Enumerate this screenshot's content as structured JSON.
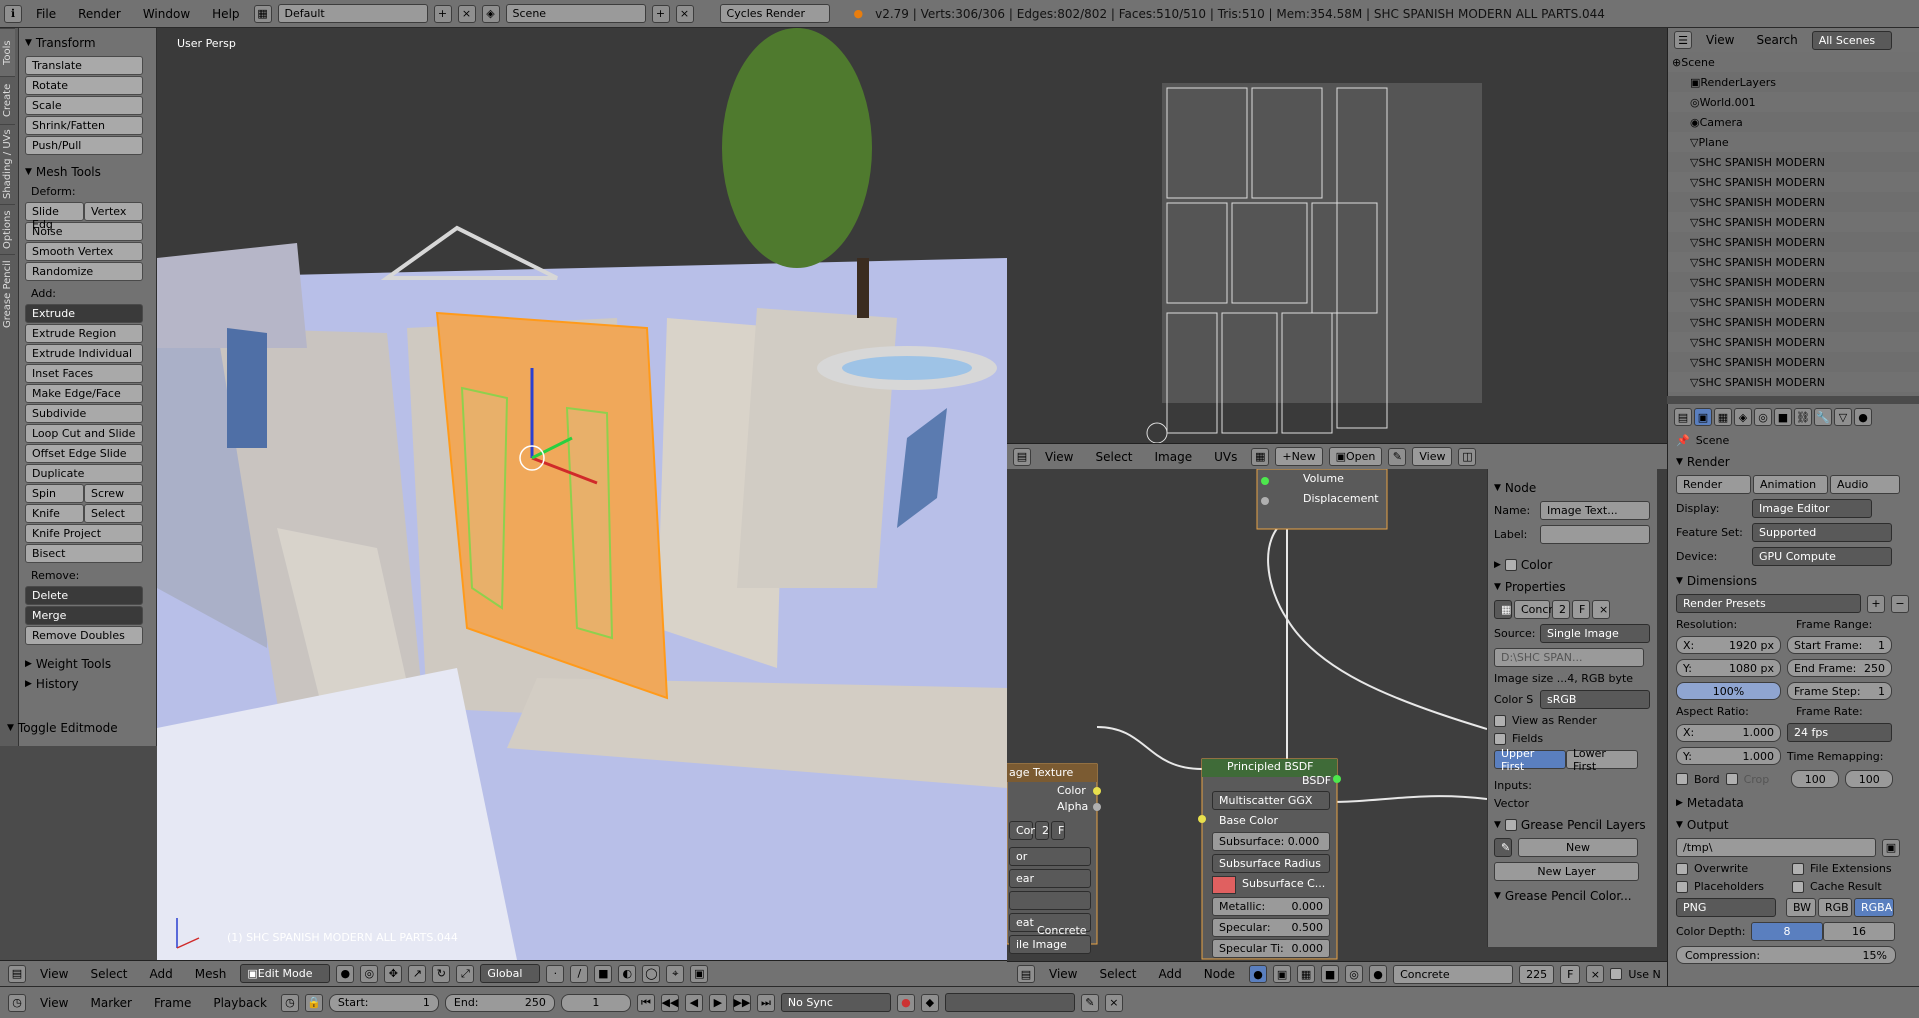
{
  "topbar": {
    "menus": [
      "File",
      "Render",
      "Window",
      "Help"
    ],
    "layout": "Default",
    "scene": "Scene",
    "engine": "Cycles Render",
    "stats": "v2.79 | Verts:306/306 | Edges:802/802 | Faces:510/510 | Tris:510 | Mem:354.58M | SHC SPANISH MODERN ALL PARTS.044"
  },
  "shelf": {
    "tabs": [
      "Tools",
      "Create",
      "Shading / UVs",
      "Options",
      "Grease Pencil"
    ],
    "transform_title": "Transform",
    "transform": [
      "Translate",
      "Rotate",
      "Scale",
      "Shrink/Fatten",
      "Push/Pull"
    ],
    "mesh_title": "Mesh Tools",
    "deform_label": "Deform:",
    "slide_edge": "Slide Edg",
    "vertex": "Vertex",
    "deform": [
      "Noise",
      "Smooth Vertex",
      "Randomize"
    ],
    "add_label": "Add:",
    "extrude": "Extrude",
    "add": [
      "Extrude Region",
      "Extrude Individual",
      "Inset Faces",
      "Make Edge/Face",
      "Subdivide",
      "Loop Cut and Slide",
      "Offset Edge Slide",
      "Duplicate"
    ],
    "spin": "Spin",
    "screw": "Screw",
    "knife": "Knife",
    "select": "Select",
    "knife_project": "Knife Project",
    "bisect": "Bisect",
    "remove_label": "Remove:",
    "delete": "Delete",
    "merge": "Merge",
    "remove_doubles": "Remove Doubles",
    "weight_tools": "Weight Tools",
    "history": "History",
    "toggle_editmode": "Toggle Editmode"
  },
  "viewport": {
    "label": "User Persp",
    "object": "(1) SHC SPANISH MODERN ALL PARTS.044",
    "node_label": "Concrete"
  },
  "vp_header": {
    "menus": [
      "View",
      "Select",
      "Add",
      "Mesh"
    ],
    "mode": "Edit Mode",
    "orientation": "Global"
  },
  "node_header_top": {
    "menus": [
      "View",
      "Select",
      "Image",
      "UVs"
    ],
    "new": "New",
    "open": "Open",
    "view": "View"
  },
  "nodes": {
    "output_sockets": [
      "Volume",
      "Displacement"
    ],
    "image_texture": "age Texture",
    "image_sockets": [
      "Color",
      "Alpha"
    ],
    "image_fields": [
      "Con",
      "2",
      "F"
    ],
    "image_rows": [
      "or",
      "ear",
      "",
      "eat",
      "ile Image"
    ],
    "bsdf_title": "Principled BSDF",
    "bsdf_out": "BSDF",
    "distribution": "Multiscatter GGX",
    "base_color": "Base Color",
    "subsurface": "Subsurface: 0.000",
    "subsurface_radius": "Subsurface Radius",
    "subsurface_color": "Subsurface C...",
    "metallic": "Metallic:",
    "metallic_v": "0.000",
    "specular": "Specular:",
    "specular_v": "0.500",
    "spec_tint": "Specular Ti:",
    "spec_tint_v": "0.000"
  },
  "node_side": {
    "node_title": "Node",
    "name_label": "Name:",
    "name_value": "Image Text...",
    "label_label": "Label:",
    "color_title": "Color",
    "properties_title": "Properties",
    "img_name": "Concr",
    "img_users": "2",
    "img_f": "F",
    "source_label": "Source:",
    "source_value": "Single Image",
    "path": "D:\\SHC SPAN...",
    "img_info": "Image size ...4, RGB byte",
    "colorspace_label": "Color S",
    "colorspace_value": "sRGB",
    "view_as_render": "View as Render",
    "fields": "Fields",
    "upper_first": "Upper First",
    "lower_first": "Lower First",
    "inputs": "Inputs:",
    "vector": "Vector",
    "grease_title": "Grease Pencil Layers",
    "new": "New",
    "new_layer": "New Layer",
    "grease_colors": "Grease Pencil Color..."
  },
  "node_header_bottom": {
    "menus": [
      "View",
      "Select",
      "Add",
      "Node"
    ],
    "material": "Concrete",
    "users": "225",
    "f": "F",
    "use_nodes": "Use N"
  },
  "outliner": {
    "menus": [
      "View",
      "Search"
    ],
    "filter": "All Scenes",
    "rows": [
      "Scene",
      "RenderLayers",
      "World.001",
      "Camera",
      "Plane",
      "SHC SPANISH MODERN",
      "SHC SPANISH MODERN",
      "SHC SPANISH MODERN",
      "SHC SPANISH MODERN",
      "SHC SPANISH MODERN",
      "SHC SPANISH MODERN",
      "SHC SPANISH MODERN",
      "SHC SPANISH MODERN",
      "SHC SPANISH MODERN",
      "SHC SPANISH MODERN",
      "SHC SPANISH MODERN",
      "SHC SPANISH MODERN"
    ]
  },
  "props": {
    "scene": "Scene",
    "render_title": "Render",
    "render": "Render",
    "animation": "Animation",
    "audio": "Audio",
    "display_label": "Display:",
    "display_value": "Image Editor",
    "feature_label": "Feature Set:",
    "feature_value": "Supported",
    "device_label": "Device:",
    "device_value": "GPU Compute",
    "dimensions_title": "Dimensions",
    "presets": "Render Presets",
    "resolution": "Resolution:",
    "frame_range": "Frame Range:",
    "res_x": "X:",
    "res_x_v": "1920 px",
    "start": "Start Frame:",
    "start_v": "1",
    "res_y": "Y:",
    "res_y_v": "1080 px",
    "end": "End Frame:",
    "end_v": "250",
    "pct": "100%",
    "step": "Frame Step:",
    "step_v": "1",
    "aspect": "Aspect Ratio:",
    "frame_rate": "Frame Rate:",
    "asp_x": "X:",
    "asp_x_v": "1.000",
    "fps": "24 fps",
    "asp_y": "Y:",
    "asp_y_v": "1.000",
    "time_remap": "Time Remapping:",
    "bord": "Bord",
    "crop": "Crop",
    "remap_old": "100",
    "remap_new": "100",
    "metadata_title": "Metadata",
    "output_title": "Output",
    "path": "/tmp\\",
    "overwrite": "Overwrite",
    "file_ext": "File Extensions",
    "placeholders": "Placeholders",
    "cache": "Cache Result",
    "format": "PNG",
    "bw": "BW",
    "rgb": "RGB",
    "rgba": "RGBA",
    "color_depth": "Color Depth:",
    "depth8": "8",
    "depth16": "16",
    "compression": "Compression:",
    "compression_v": "15%"
  },
  "timeline": {
    "menus": [
      "View",
      "Marker",
      "Frame",
      "Playback"
    ],
    "start": "Start:",
    "start_v": "1",
    "end": "End:",
    "end_v": "250",
    "current": "1",
    "sync": "No Sync"
  }
}
